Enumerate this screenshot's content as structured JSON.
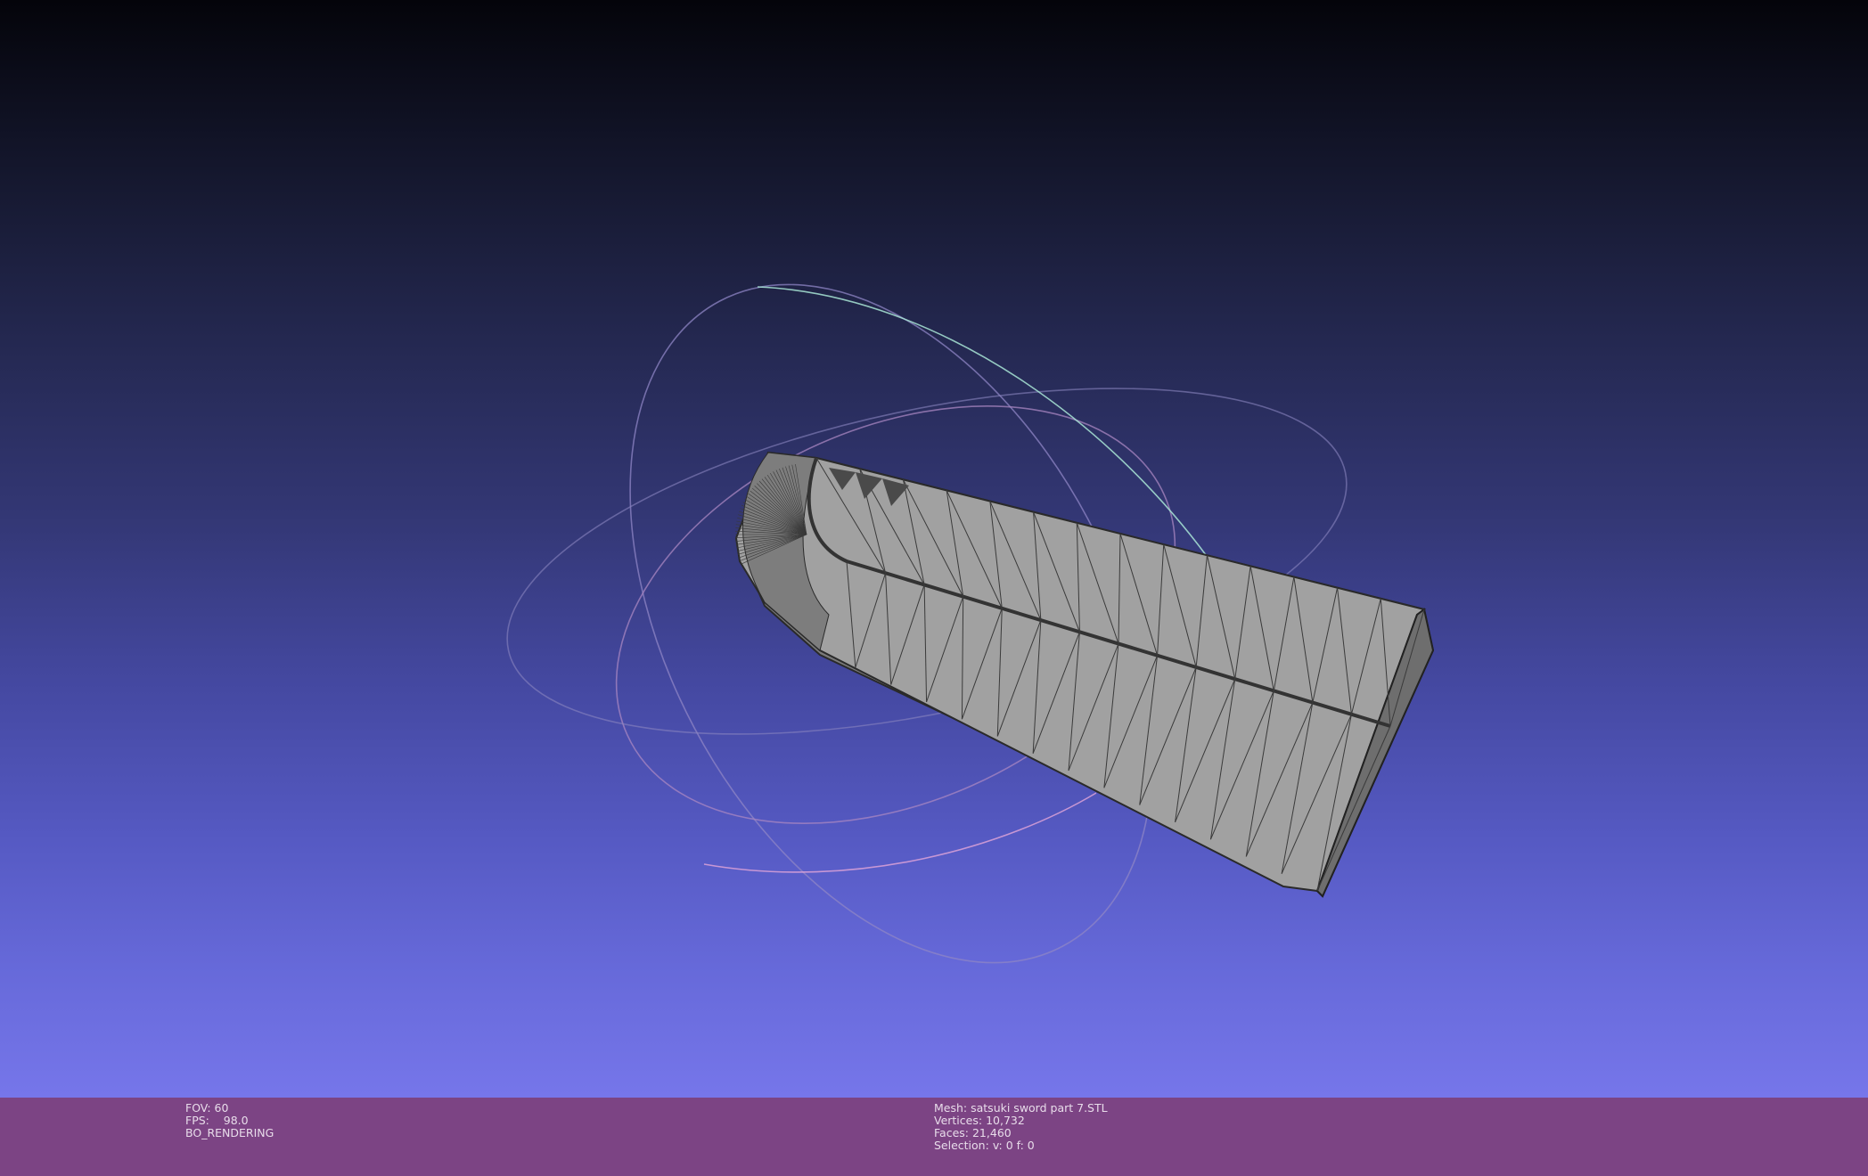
{
  "viewport": {
    "background_top": "#04040a",
    "background_bottom": "#7676ea",
    "mesh_color": "#a0a0a0",
    "wire_color": "#2e2e2e",
    "trackball_colors": [
      "#b07fb8",
      "#8fd0c8",
      "#9a8ad0"
    ]
  },
  "info_left": {
    "fov_label": "FOV:",
    "fov_value": "60",
    "fps_label": "FPS:",
    "fps_value": "98.0",
    "render_mode": "BO_RENDERING"
  },
  "info_right": {
    "mesh_label": "Mesh:",
    "mesh_name": "satsuki sword part 7.STL",
    "vertices_label": "Vertices:",
    "vertices_value": "10,732",
    "faces_label": "Faces:",
    "faces_value": "21,460",
    "selection_label": "Selection:",
    "selection_value": "v: 0 f: 0"
  }
}
